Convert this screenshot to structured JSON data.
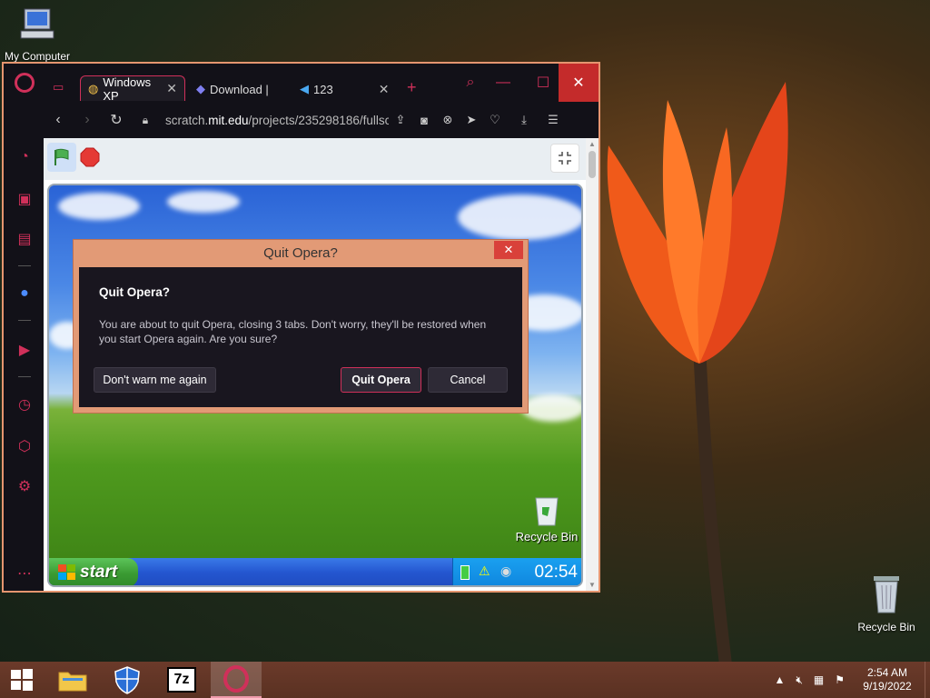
{
  "desktop": {
    "icons": {
      "my_computer": "My Computer",
      "recycle_bin": "Recycle Bin"
    }
  },
  "taskbar": {
    "apps": [
      "file-explorer-icon",
      "shield-icon",
      "7zip-icon",
      "opera-icon"
    ],
    "tray": {
      "time": "2:54 AM",
      "date": "9/19/2022"
    }
  },
  "browser": {
    "tabs": [
      {
        "label": "Windows XP",
        "icon": "lightbulb-icon"
      },
      {
        "label": "Download |",
        "icon": "pen-icon"
      },
      {
        "label": "123",
        "icon": "fish-icon"
      }
    ],
    "new_tab": "+",
    "address": {
      "host": "scratch.",
      "host_bold": "mit.edu",
      "path": "/projects/235298186/fullsc"
    },
    "sidebar": [
      "speed-dial-icon",
      "shopping-icon",
      "twitch-icon",
      "messenger-icon",
      "player-icon",
      "history-icon",
      "extensions-icon",
      "settings-icon",
      "more-icon"
    ]
  },
  "scratch": {
    "xp_clock": "02:54",
    "xp_start": "start",
    "xp_recycle": "Recycle Bin"
  },
  "dialog": {
    "title": "Quit Opera?",
    "heading": "Quit Opera?",
    "message": "You are about to quit Opera, closing 3 tabs. Don't worry, they'll be restored when you start Opera again. Are you sure?",
    "dont_warn": "Don't warn me again",
    "quit": "Quit Opera",
    "cancel": "Cancel"
  }
}
